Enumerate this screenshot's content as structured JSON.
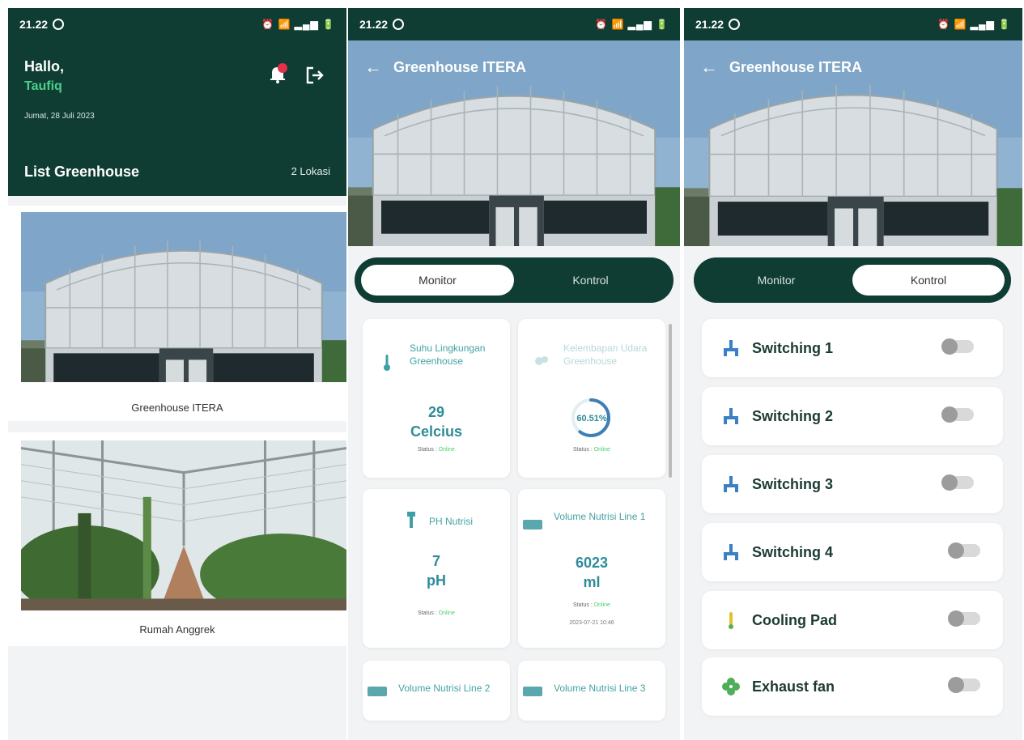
{
  "status_bar": {
    "time": "21.22",
    "icons": "⏰ 📶 ▂▄▆ 🔋"
  },
  "home": {
    "greeting": "Hallo,",
    "user_name": "Taufiq",
    "date": "Jumat, 28 Juli 2023",
    "list_title": "List Greenhouse",
    "list_count": "2 Lokasi",
    "greenhouses": [
      {
        "name": "Greenhouse ITERA"
      },
      {
        "name": "Rumah Anggrek"
      }
    ],
    "colors": {
      "header": "#0f3d33",
      "accent": "#4ccf8a",
      "bell": "#e8304a"
    }
  },
  "detail": {
    "title": "Greenhouse ITERA",
    "tabs": {
      "monitor": "Monitor",
      "kontrol": "Kontrol"
    },
    "monitor_cards": [
      {
        "title": "Suhu Lingkungan Greenhouse",
        "value": "29",
        "unit": "Celcius",
        "status_label": "Status :",
        "status": "Online"
      },
      {
        "title": "Kelembapan Udara Greenhouse",
        "value": "60.51%",
        "status_label": "Status :",
        "status": "Online"
      },
      {
        "title": "PH Nutrisi",
        "value": "7",
        "unit": "pH",
        "status_label": "Status :",
        "status": "Online"
      },
      {
        "title": "Volume Nutrisi Line 1",
        "value": "6023",
        "unit": "ml",
        "status_label": "Status :",
        "status": "Online",
        "timestamp": "2023-07-21 10:46"
      },
      {
        "title": "Volume Nutrisi Line 2"
      },
      {
        "title": "Volume Nutrisi Line 3"
      }
    ],
    "controls": [
      {
        "label": "Switching 1",
        "icon": "pump-icon",
        "on": false
      },
      {
        "label": "Switching 2",
        "icon": "pump-icon",
        "on": false
      },
      {
        "label": "Switching 3",
        "icon": "pump-icon",
        "on": false
      },
      {
        "label": "Switching 4",
        "icon": "pump-icon",
        "on": false
      },
      {
        "label": "Cooling Pad",
        "icon": "thermometer-icon",
        "on": false
      },
      {
        "label": "Exhaust fan",
        "icon": "fan-icon",
        "on": false
      }
    ],
    "colors": {
      "dark": "#0f3d33",
      "teal": "#2e8c99",
      "online": "#4ccf6a"
    }
  }
}
